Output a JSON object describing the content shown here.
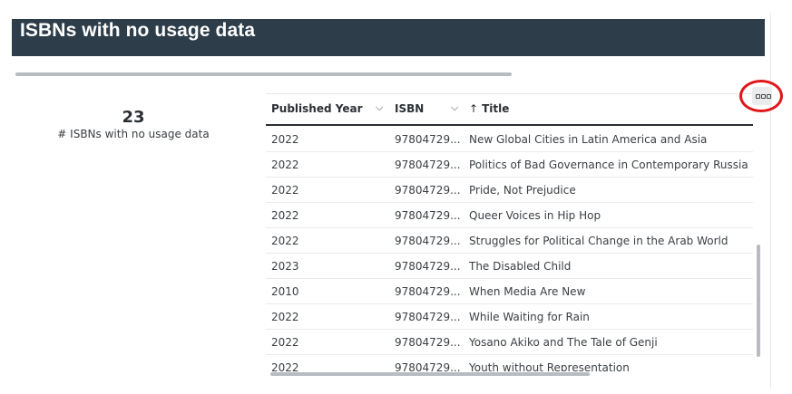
{
  "header": {
    "title": "ISBNs with no usage data"
  },
  "kpi": {
    "value": "23",
    "label": "# ISBNs with no usage data"
  },
  "table": {
    "columns": [
      {
        "label": "Published Year"
      },
      {
        "label": "ISBN"
      },
      {
        "label": "Title",
        "sort": "ascending"
      }
    ],
    "rows": [
      {
        "year": "2022",
        "isbn": "97804729...",
        "title": "New Global Cities in Latin America and Asia"
      },
      {
        "year": "2022",
        "isbn": "97804729...",
        "title": "Politics of Bad Governance in Contemporary Russia"
      },
      {
        "year": "2022",
        "isbn": "97804729...",
        "title": "Pride, Not Prejudice"
      },
      {
        "year": "2022",
        "isbn": "97804729...",
        "title": "Queer Voices in Hip Hop"
      },
      {
        "year": "2022",
        "isbn": "97804729...",
        "title": "Struggles for Political Change in the Arab World"
      },
      {
        "year": "2023",
        "isbn": "97804729...",
        "title": "The Disabled Child"
      },
      {
        "year": "2010",
        "isbn": "97804729...",
        "title": "When Media Are New"
      },
      {
        "year": "2022",
        "isbn": "97804729...",
        "title": "While Waiting for Rain"
      },
      {
        "year": "2022",
        "isbn": "97804729...",
        "title": "Yosano Akiko and The Tale of Genji"
      },
      {
        "year": "2022",
        "isbn": "97804729...",
        "title": "Youth without Representation"
      }
    ]
  },
  "icons": {
    "sort_arrow": "arrow-up-icon",
    "column_menu": "chevron-down-icon",
    "more": "more-options-icon"
  },
  "colors": {
    "header_bg": "#2d3d49",
    "highlight": "#e0161b"
  }
}
